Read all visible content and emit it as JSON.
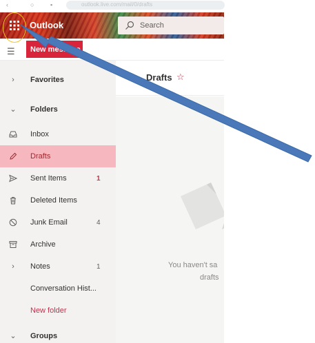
{
  "browser": {
    "url_text": "outlook.live.com/mail/0/drafts"
  },
  "header": {
    "app_name": "Outlook",
    "search_placeholder": "Search",
    "app_launcher_icon": "waffle-grid-icon"
  },
  "toolbar": {
    "new_message_label": "New message"
  },
  "sidebar": {
    "favorites": "Favorites",
    "folders": "Folders",
    "items": [
      {
        "label": "Inbox",
        "count": "",
        "icon": "inbox-icon"
      },
      {
        "label": "Drafts",
        "count": "",
        "icon": "pencil-icon"
      },
      {
        "label": "Sent Items",
        "count": "1",
        "icon": "send-icon"
      },
      {
        "label": "Deleted Items",
        "count": "",
        "icon": "trash-icon"
      },
      {
        "label": "Junk Email",
        "count": "4",
        "icon": "block-icon"
      },
      {
        "label": "Archive",
        "count": "",
        "icon": "archive-icon"
      },
      {
        "label": "Notes",
        "count": "1",
        "icon": "chevron-right-icon"
      },
      {
        "label": "Conversation Hist...",
        "count": ""
      },
      {
        "label": "New folder",
        "count": ""
      }
    ],
    "groups": "Groups"
  },
  "content": {
    "title": "Drafts",
    "empty_line_1": "You haven't sa",
    "empty_line_2": "drafts"
  },
  "colors": {
    "accent": "#d8253c",
    "selected_bg": "#f7b7bf",
    "annotation_arrow": "#4a78b8",
    "annotation_ring": "#f3c22c"
  }
}
